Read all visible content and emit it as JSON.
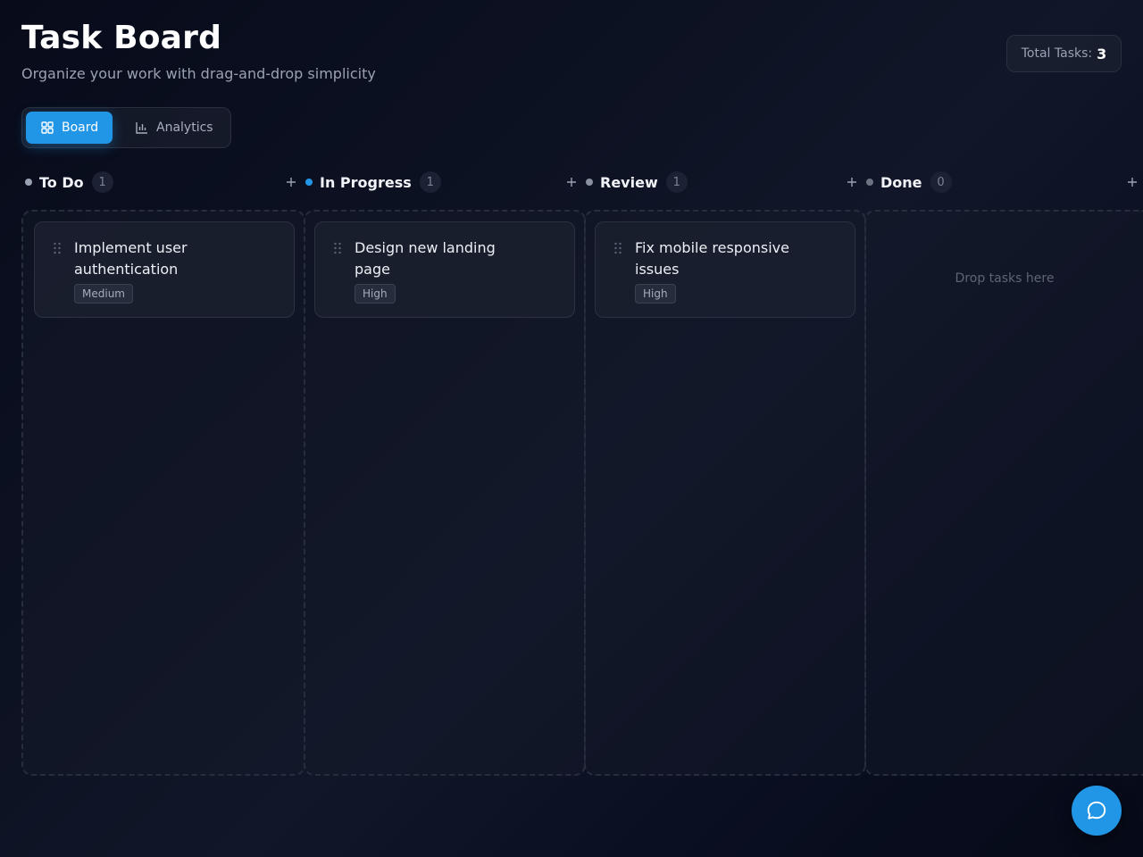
{
  "header": {
    "title": "Task Board",
    "subtitle": "Organize your work with drag-and-drop simplicity",
    "total_label": "Total Tasks:",
    "total_count": "3"
  },
  "view_switch": {
    "board_label": "Board",
    "board_icon": "grid-icon",
    "analytics_label": "Analytics",
    "analytics_icon": "bar-chart-icon",
    "active": "Board",
    "accent_color": "#2196e6"
  },
  "columns": [
    {
      "title": "To Do",
      "count": "1",
      "dot_color": "#9aa1b2",
      "add_icon": "plus-icon",
      "tasks": [
        {
          "title": "Implement user authentication",
          "priority": "Medium"
        }
      ]
    },
    {
      "title": "In Progress",
      "count": "1",
      "dot_color": "#2196e6",
      "add_icon": "plus-icon",
      "tasks": [
        {
          "title": "Design new landing page",
          "priority": "High"
        }
      ]
    },
    {
      "title": "Review",
      "count": "1",
      "dot_color": "#8a90a0",
      "add_icon": "plus-icon",
      "tasks": [
        {
          "title": "Fix mobile responsive issues",
          "priority": "High"
        }
      ]
    },
    {
      "title": "Done",
      "count": "0",
      "dot_color": "#6c7282",
      "add_icon": "plus-icon",
      "tasks": [],
      "empty_hint": "Drop tasks here"
    }
  ],
  "chat_button": {
    "icon": "chat-bubble-icon"
  }
}
